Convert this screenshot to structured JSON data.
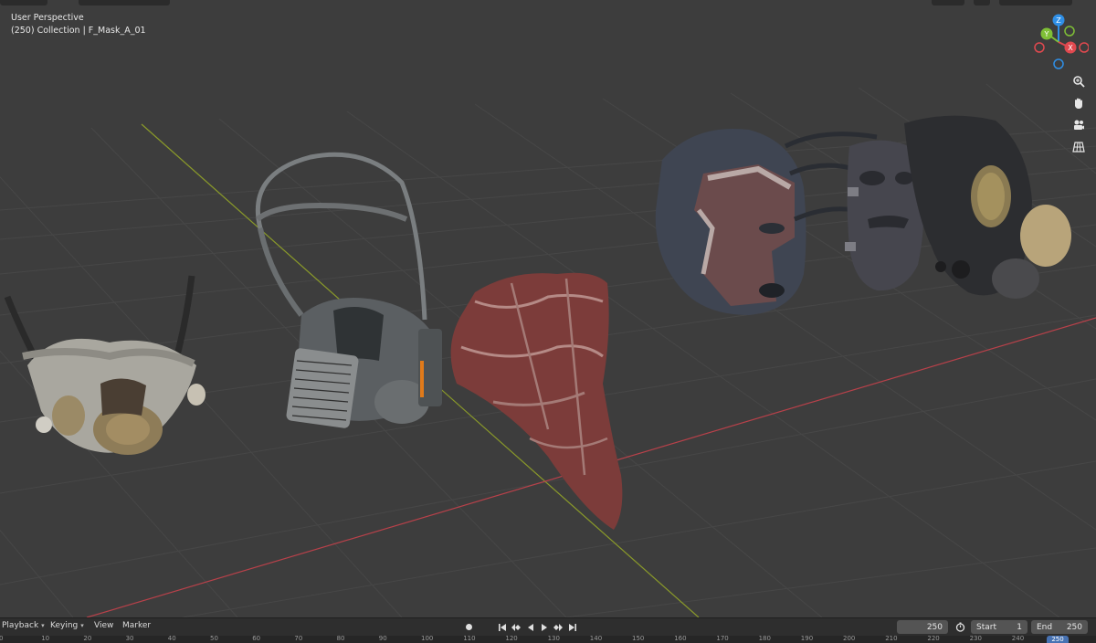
{
  "viewport": {
    "title": "User Perspective",
    "collection": "(250) Collection | F_Mask_A_01"
  },
  "gizmo": {
    "axes": [
      {
        "label": "Z",
        "color": "#2f8fe6"
      },
      {
        "label": "Y",
        "color": "#7fbf36"
      },
      {
        "label": "X",
        "color": "#e0494f"
      }
    ]
  },
  "side_tools": [
    {
      "name": "zoom-icon"
    },
    {
      "name": "hand-pan-icon"
    },
    {
      "name": "camera-icon"
    },
    {
      "name": "grid-ortho-icon"
    }
  ],
  "timeline": {
    "menus": [
      "Playback",
      "Keying",
      "View",
      "Marker"
    ],
    "current_frame": "250",
    "start_label": "Start",
    "start_value": "1",
    "end_label": "End",
    "end_value": "250"
  },
  "ruler": {
    "ticks": [
      "0",
      "10",
      "20",
      "30",
      "40",
      "50",
      "60",
      "70",
      "80",
      "90",
      "100",
      "110",
      "120",
      "130",
      "140",
      "150",
      "160",
      "170",
      "180",
      "190",
      "200",
      "210",
      "220",
      "230",
      "240",
      "250"
    ]
  },
  "colors": {
    "background": "#3d3d3d",
    "grid": "#4a4a4a",
    "x_axis": "#b8414a",
    "y_axis": "#8a9a2a",
    "accent": "#4772b3"
  }
}
